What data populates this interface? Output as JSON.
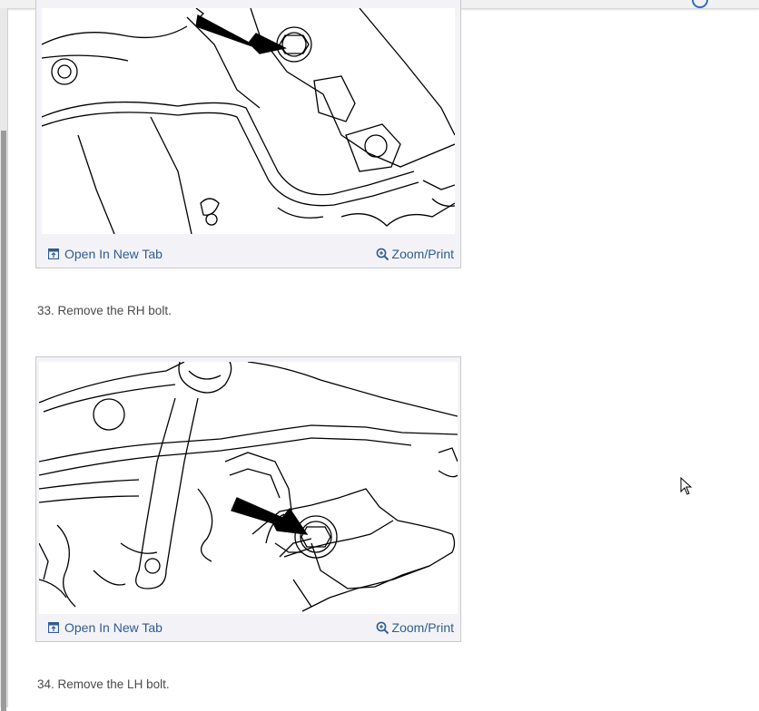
{
  "figures": [
    {
      "open_label": "Open In New Tab",
      "zoom_label": "Zoom/Print",
      "open_icon": "open-new-tab-icon",
      "zoom_icon": "magnifier-plus-icon"
    },
    {
      "open_label": "Open In New Tab",
      "zoom_label": "Zoom/Print",
      "open_icon": "open-new-tab-icon",
      "zoom_icon": "magnifier-plus-icon"
    }
  ],
  "steps": [
    "33. Remove the RH bolt.",
    "34. Remove the LH bolt."
  ],
  "colors": {
    "link": "#2f5c8f",
    "text": "#4a4a4a",
    "figure_bg": "#f3f3f7"
  }
}
